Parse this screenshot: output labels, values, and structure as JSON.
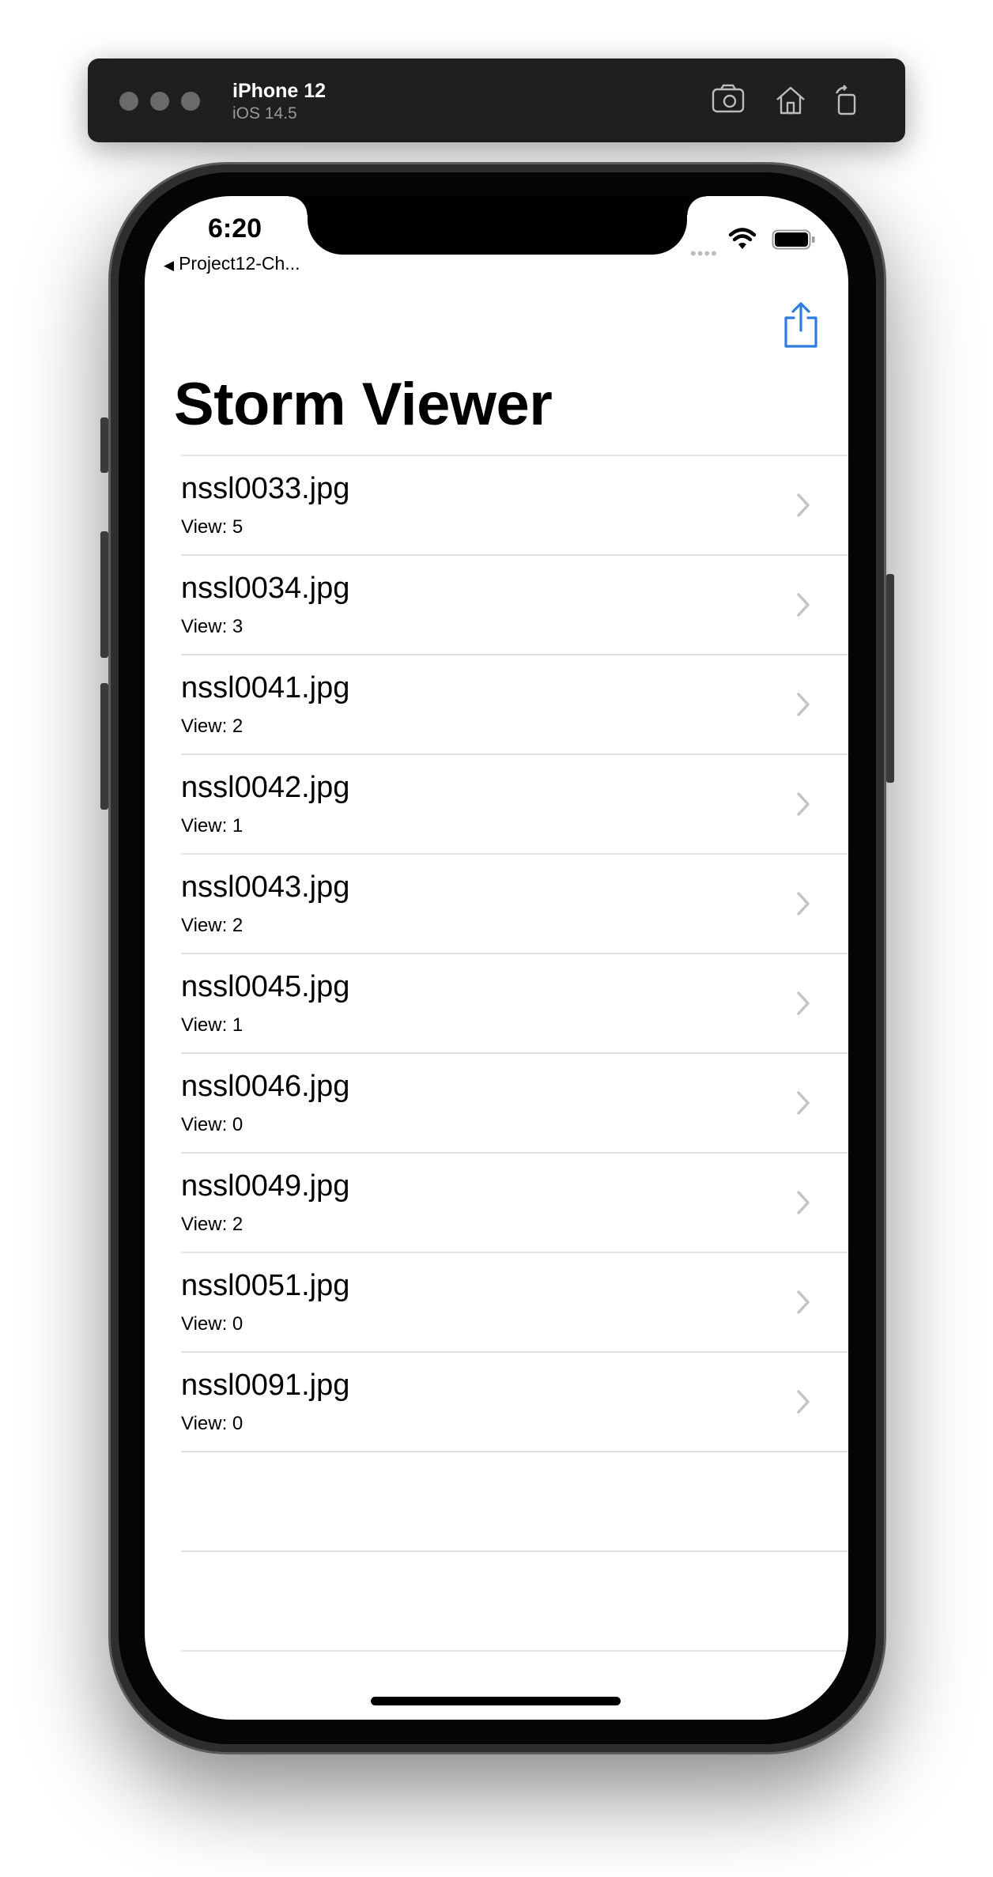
{
  "simulator": {
    "device_name": "iPhone 12",
    "os_version": "iOS 14.5",
    "toolbar_icons": [
      "screenshot-icon",
      "home-icon",
      "rotate-icon"
    ]
  },
  "status_bar": {
    "time": "6:20",
    "back_app": "Project12-Ch...",
    "icons": [
      "cellular-dots-icon",
      "wifi-icon",
      "battery-icon"
    ]
  },
  "nav": {
    "title": "Storm Viewer",
    "right_button_icon": "share-icon",
    "accent_color": "#2f7bde"
  },
  "table": {
    "rows": [
      {
        "title": "nssl0033.jpg",
        "subtitle": "View: 5"
      },
      {
        "title": "nssl0034.jpg",
        "subtitle": "View: 3"
      },
      {
        "title": "nssl0041.jpg",
        "subtitle": "View: 2"
      },
      {
        "title": "nssl0042.jpg",
        "subtitle": "View: 1"
      },
      {
        "title": "nssl0043.jpg",
        "subtitle": "View: 2"
      },
      {
        "title": "nssl0045.jpg",
        "subtitle": "View: 1"
      },
      {
        "title": "nssl0046.jpg",
        "subtitle": "View: 0"
      },
      {
        "title": "nssl0049.jpg",
        "subtitle": "View: 2"
      },
      {
        "title": "nssl0051.jpg",
        "subtitle": "View: 0"
      },
      {
        "title": "nssl0091.jpg",
        "subtitle": "View: 0"
      }
    ]
  }
}
